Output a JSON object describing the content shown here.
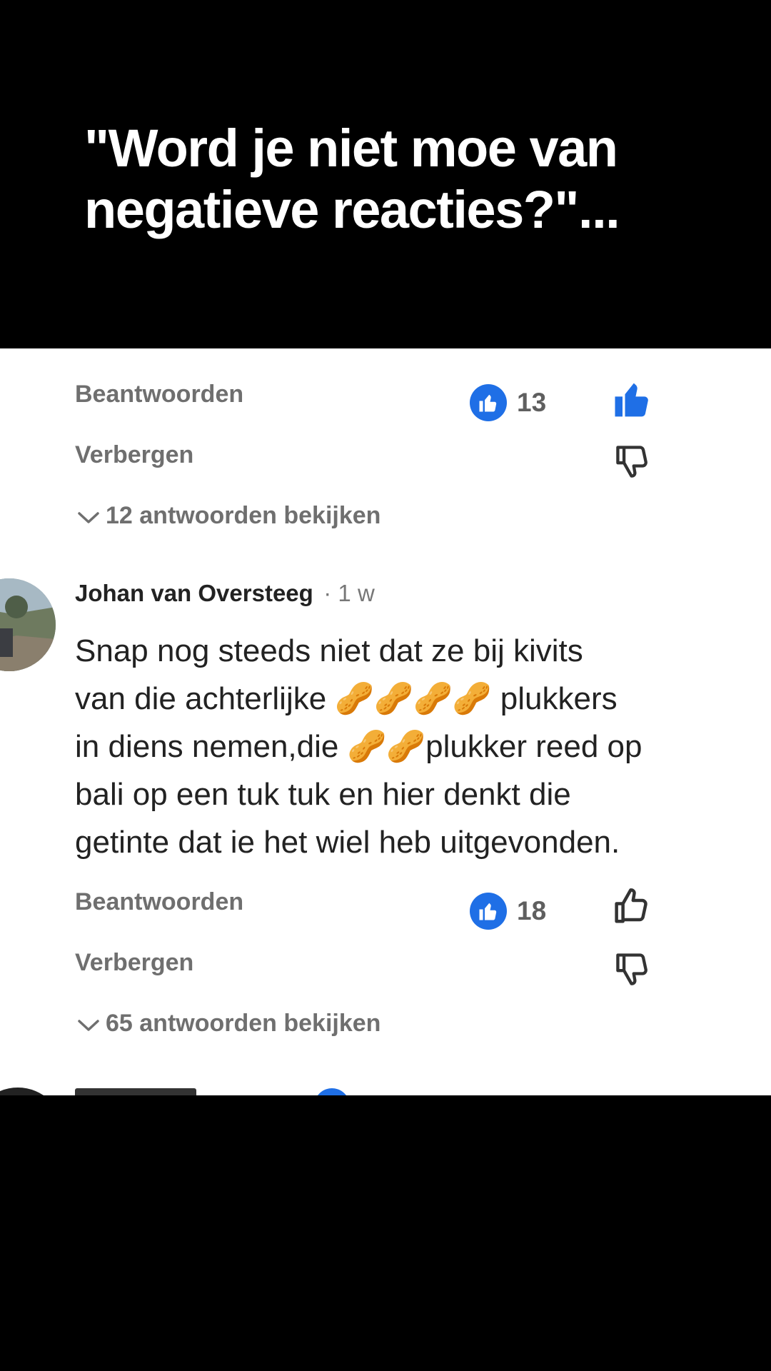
{
  "caption": "\"Word je niet moe van negatieve reacties?\"...",
  "comment_top": {
    "reply_label": "Beantwoorden",
    "hide_label": "Verbergen",
    "likes": "13",
    "view_replies": "12 antwoorden bekijken"
  },
  "comment_main": {
    "username": "Johan van Oversteeg",
    "timestamp": "· 1 w",
    "text_lines": [
      "Snap nog steeds niet dat ze bij kivits",
      "van die achterlijke 🥜🥜🥜🥜 plukkers",
      "in diens nemen,die 🥜🥜plukker reed op",
      "bali op een tuk tuk en hier denkt die",
      "getinte dat ie het wiel heb uitgevonden."
    ],
    "reply_label": "Beantwoorden",
    "hide_label": "Verbergen",
    "likes": "18",
    "view_replies": "65 antwoorden bekijken"
  },
  "colors": {
    "accent": "#1f6fe6",
    "background": "#000000",
    "panel": "#ffffff"
  },
  "icons": {
    "like_badge": "thumbs-up-icon",
    "like": "thumbs-up-icon",
    "dislike": "thumbs-down-icon",
    "expand": "chevron-down-icon"
  }
}
